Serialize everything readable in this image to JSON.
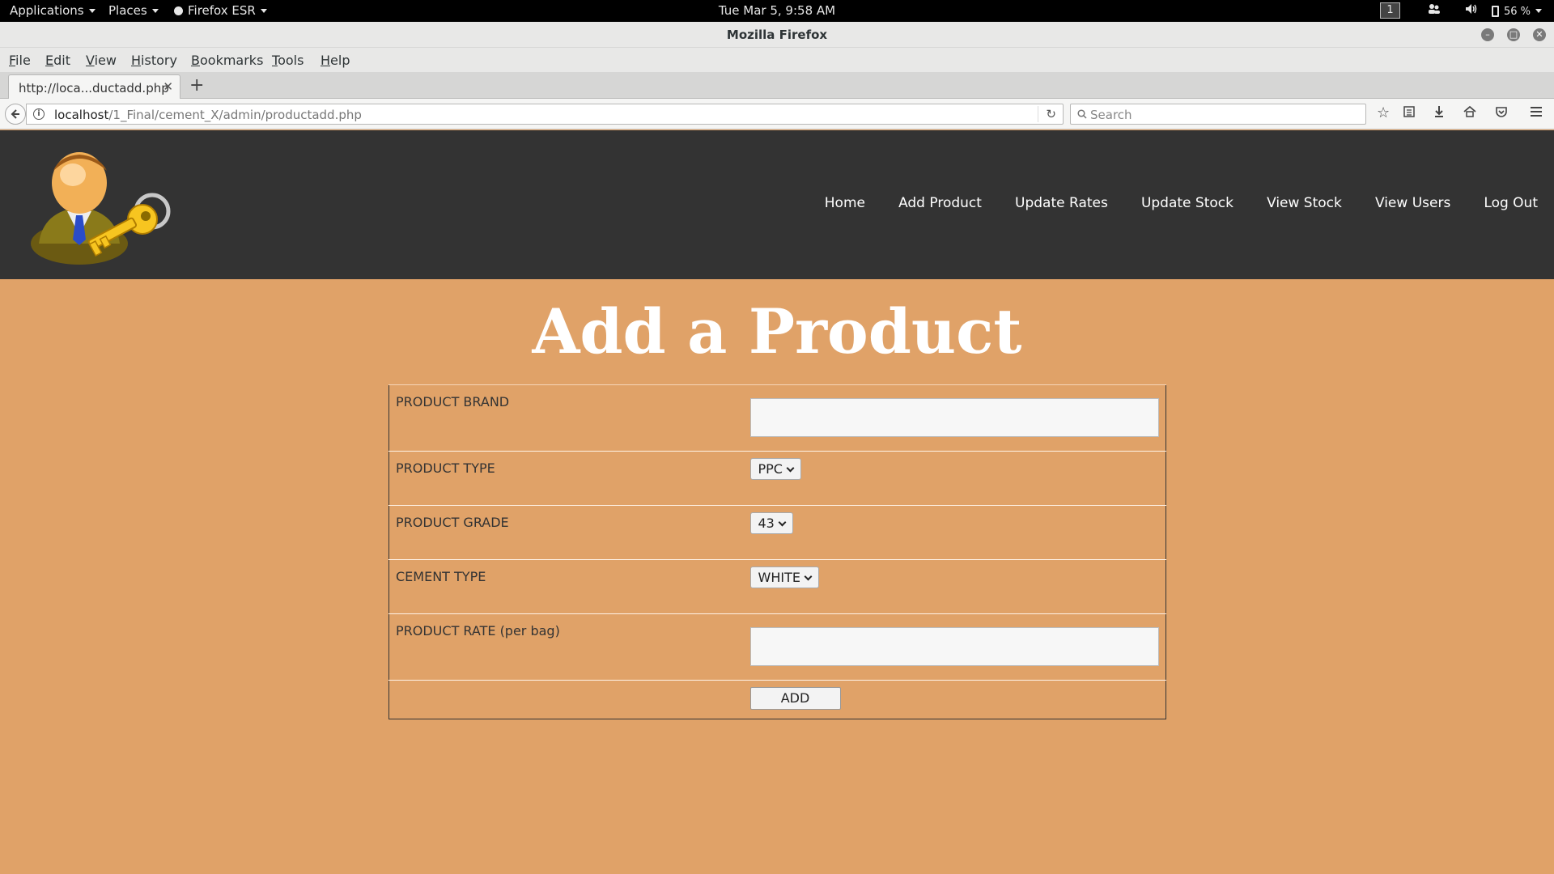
{
  "gnome": {
    "applications": "Applications",
    "places": "Places",
    "firefox": "Firefox ESR",
    "clock": "Tue Mar  5,  9:58 AM",
    "workspace": "1",
    "battery": "56 %"
  },
  "window": {
    "title": "Mozilla Firefox"
  },
  "menu": {
    "file": "File",
    "edit": "Edit",
    "view": "View",
    "history": "History",
    "bookmarks": "Bookmarks",
    "tools": "Tools",
    "help": "Help"
  },
  "tab": {
    "title": "http://loca...ductadd.php"
  },
  "urlbar": {
    "host": "localhost",
    "path": "/1_Final/cement_X/admin/productadd.php"
  },
  "search": {
    "placeholder": "Search"
  },
  "site_nav": [
    "Home",
    "Add Product",
    "Update Rates",
    "Update Stock",
    "View Stock",
    "View Users",
    "Log Out"
  ],
  "page": {
    "title": "Add a Product"
  },
  "form": {
    "brand_label": "PRODUCT BRAND",
    "brand_value": "",
    "type_label": "PRODUCT TYPE",
    "type_value": "PPC",
    "grade_label": "PRODUCT GRADE",
    "grade_value": "43",
    "cement_label": "CEMENT TYPE",
    "cement_value": "WHITE",
    "rate_label": "PRODUCT RATE (per bag)",
    "rate_value": "",
    "submit": "ADD"
  },
  "icons": {
    "logo": "admin-key-logo",
    "colors": {
      "header_bg": "#333333",
      "page_bg": "#e0a268"
    }
  }
}
